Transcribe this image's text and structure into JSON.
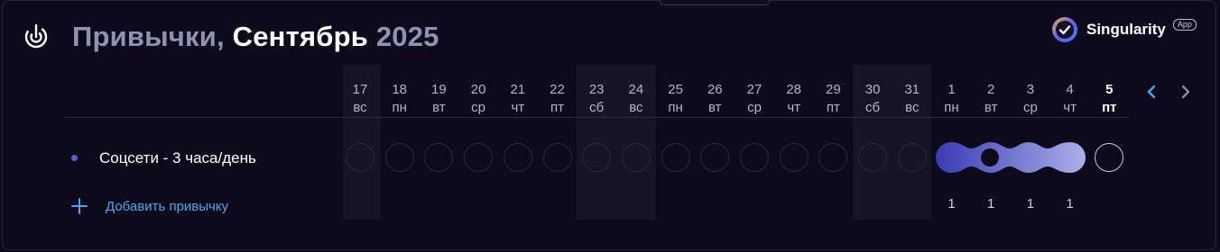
{
  "header": {
    "title_prefix": "Привычки,",
    "month": "Сентябрь",
    "year": "2025",
    "icon": "habit-target-icon"
  },
  "brand": {
    "name": "Singularity",
    "badge": "App",
    "icon": "singularity-check-logo"
  },
  "calendar": {
    "dates": [
      {
        "day": "17",
        "weekday": "вс"
      },
      {
        "day": "18",
        "weekday": "пн"
      },
      {
        "day": "19",
        "weekday": "вт"
      },
      {
        "day": "20",
        "weekday": "ср"
      },
      {
        "day": "21",
        "weekday": "чт"
      },
      {
        "day": "22",
        "weekday": "пт"
      },
      {
        "day": "23",
        "weekday": "сб"
      },
      {
        "day": "24",
        "weekday": "вс"
      },
      {
        "day": "25",
        "weekday": "пн"
      },
      {
        "day": "26",
        "weekday": "вт"
      },
      {
        "day": "27",
        "weekday": "ср"
      },
      {
        "day": "28",
        "weekday": "чт"
      },
      {
        "day": "29",
        "weekday": "пт"
      },
      {
        "day": "30",
        "weekday": "сб"
      },
      {
        "day": "31",
        "weekday": "вс"
      },
      {
        "day": "1",
        "weekday": "пн"
      },
      {
        "day": "2",
        "weekday": "вт"
      },
      {
        "day": "3",
        "weekday": "ср"
      },
      {
        "day": "4",
        "weekday": "чт"
      },
      {
        "day": "5",
        "weekday": "пт"
      }
    ],
    "today_index": 19,
    "nav": {
      "prev_icon": "chevron-left-icon",
      "next_icon": "chevron-right-icon"
    }
  },
  "habits": [
    {
      "name": "Соцсети - 3 часа/день",
      "completed_indices": [
        15,
        16,
        17,
        18
      ],
      "counts": [
        "1",
        "1",
        "1",
        "1"
      ],
      "color": "#5b5fd6"
    }
  ],
  "add_habit": {
    "label": "Добавить привычку",
    "icon": "plus-icon"
  },
  "colors": {
    "background": "#0d0a1c",
    "accent_blue": "#4aa6f0",
    "streak_start": "#3f3fb8",
    "streak_end": "#a9aee6"
  }
}
